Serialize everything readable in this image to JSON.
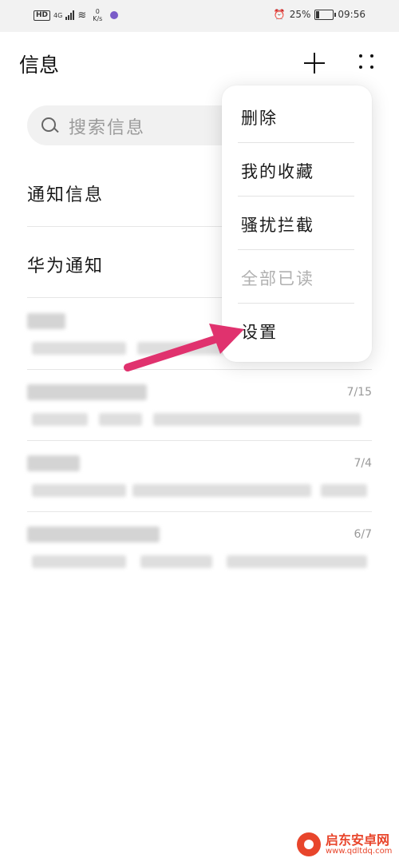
{
  "status_bar": {
    "network": "HD",
    "network_gen": "4G",
    "speed_value": "0",
    "speed_unit": "K/s",
    "battery_percent": "25%",
    "time": "09:56",
    "icons": [
      "hd-icon",
      "signal-icon",
      "wifi-icon",
      "app-notification-icon",
      "alarm-icon",
      "battery-icon"
    ]
  },
  "header": {
    "title": "信息",
    "add_icon": "plus-icon",
    "more_icon": "more-dots-icon"
  },
  "search": {
    "placeholder": "搜索信息",
    "icon": "search-icon"
  },
  "sections": [
    {
      "label": "通知信息"
    },
    {
      "label": "华为通知"
    }
  ],
  "conversations": [
    {
      "date": ""
    },
    {
      "date": "7/15"
    },
    {
      "date": "7/4"
    },
    {
      "date": "6/7"
    }
  ],
  "menu": {
    "items": [
      {
        "label": "删除",
        "enabled": true
      },
      {
        "label": "我的收藏",
        "enabled": true
      },
      {
        "label": "骚扰拦截",
        "enabled": true
      },
      {
        "label": "全部已读",
        "enabled": false
      },
      {
        "label": "设置",
        "enabled": true
      }
    ]
  },
  "annotation": {
    "color": "#e0326e",
    "points_to": "设置"
  },
  "watermark": {
    "brand": "启东安卓网",
    "url": "www.qdltdq.com"
  },
  "colors": {
    "background": "#ffffff",
    "statusbar": "#f2f2f2",
    "search_bg": "#f1f1f1",
    "arrow": "#e0326e",
    "disabled_text": "#b0b0b0"
  }
}
